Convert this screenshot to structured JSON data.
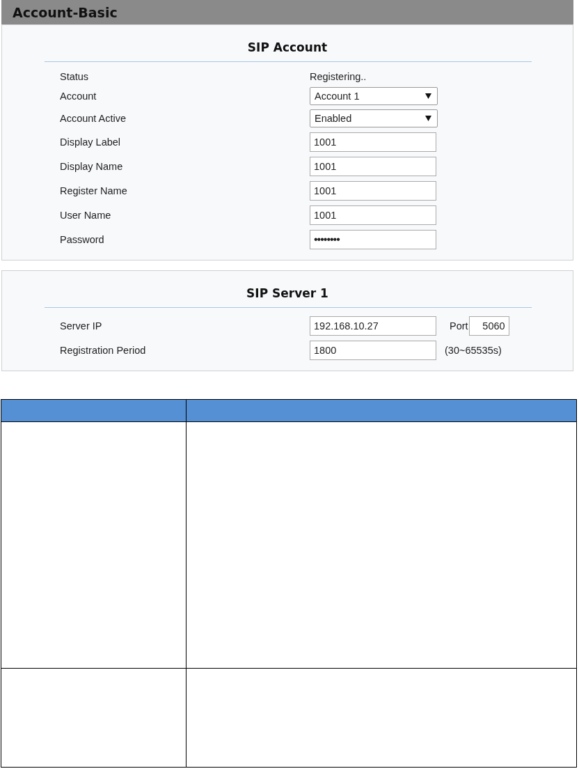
{
  "page_title": "Account-Basic",
  "panels": [
    {
      "title": "SIP Account",
      "rows": [
        {
          "kind": "text",
          "label": "Status",
          "value": "Registering.."
        },
        {
          "kind": "select",
          "label": "Account",
          "value": "Account 1"
        },
        {
          "kind": "select",
          "label": "Account Active",
          "value": "Enabled"
        },
        {
          "kind": "input",
          "label": "Display Label",
          "value": "1001"
        },
        {
          "kind": "input",
          "label": "Display Name",
          "value": "1001"
        },
        {
          "kind": "input",
          "label": "Register Name",
          "value": "1001"
        },
        {
          "kind": "input",
          "label": "User Name",
          "value": "1001"
        },
        {
          "kind": "password",
          "label": "Password",
          "value": "••••••••"
        }
      ]
    },
    {
      "title": "SIP Server 1",
      "rows": [
        {
          "kind": "input",
          "label": "Server IP",
          "value": "192.168.10.27",
          "extra_label": "Port",
          "extra_value": "5060"
        },
        {
          "kind": "input",
          "label": "Registration Period",
          "value": "1800",
          "hint": "(30~65535s)"
        }
      ]
    }
  ]
}
